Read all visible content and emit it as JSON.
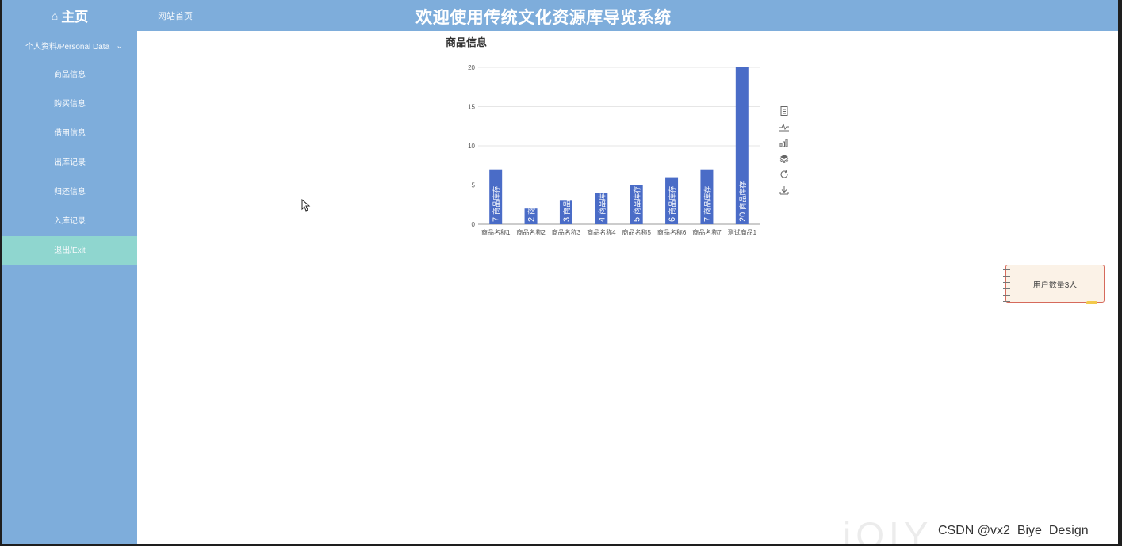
{
  "header": {
    "home_icon": "home-icon",
    "home_label": "主页",
    "site_link": "网站首页",
    "title": "欢迎使用传统文化资源库导览系统"
  },
  "sidebar": {
    "group_label": "个人资料/Personal Data",
    "items": [
      {
        "label": "商品信息"
      },
      {
        "label": "购买信息"
      },
      {
        "label": "借用信息"
      },
      {
        "label": "出库记录"
      },
      {
        "label": "归还信息"
      },
      {
        "label": "入库记录"
      },
      {
        "label": "退出/Exit"
      }
    ]
  },
  "chart_data": {
    "type": "bar",
    "title": "商品信息",
    "categories": [
      "商品名称1",
      "商品名称2",
      "商品名称3",
      "商品名称4",
      "商品名称5",
      "商品名称6",
      "商品名称7",
      "测试商品1"
    ],
    "series": [
      {
        "name": "商品库存",
        "values": [
          7,
          2,
          3,
          4,
          5,
          6,
          7,
          20
        ]
      }
    ],
    "ylim": [
      0,
      20
    ],
    "yticks": [
      0,
      5,
      10,
      15,
      20
    ],
    "grid": true,
    "bar_color": "#4a6cc7"
  },
  "toolbox": [
    "data-view-icon",
    "line-chart-icon",
    "bar-chart-icon",
    "stack-icon",
    "restore-icon",
    "download-icon"
  ],
  "card": {
    "text": "用户数量3人"
  },
  "watermark": "CSDN @vx2_Biye_Design"
}
